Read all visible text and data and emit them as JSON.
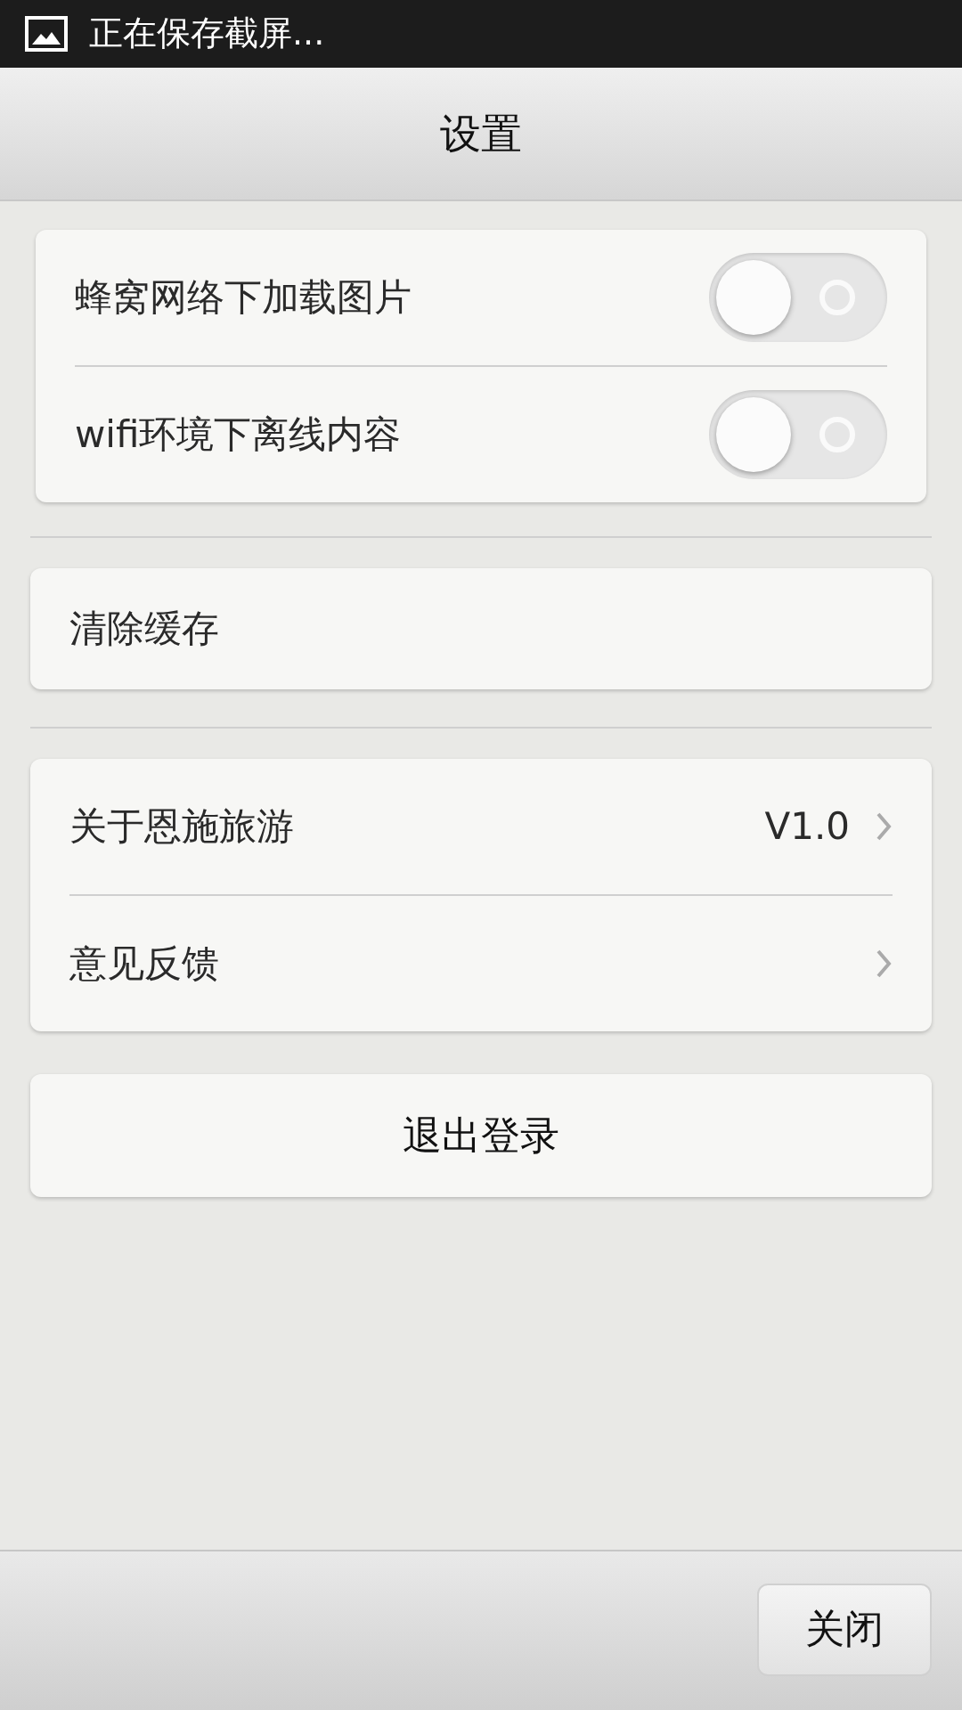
{
  "status_bar": {
    "notification": "正在保存截屏..."
  },
  "header": {
    "title": "设置"
  },
  "toggles": [
    {
      "label": "蜂窝网络下加载图片",
      "on": false
    },
    {
      "label": "wifi环境下离线内容",
      "on": false
    }
  ],
  "cache": {
    "label": "清除缓存"
  },
  "info": [
    {
      "label": "关于恩施旅游",
      "value": "V1.0"
    },
    {
      "label": "意见反馈"
    }
  ],
  "logout": {
    "label": "退出登录"
  },
  "footer": {
    "button": "关闭"
  }
}
